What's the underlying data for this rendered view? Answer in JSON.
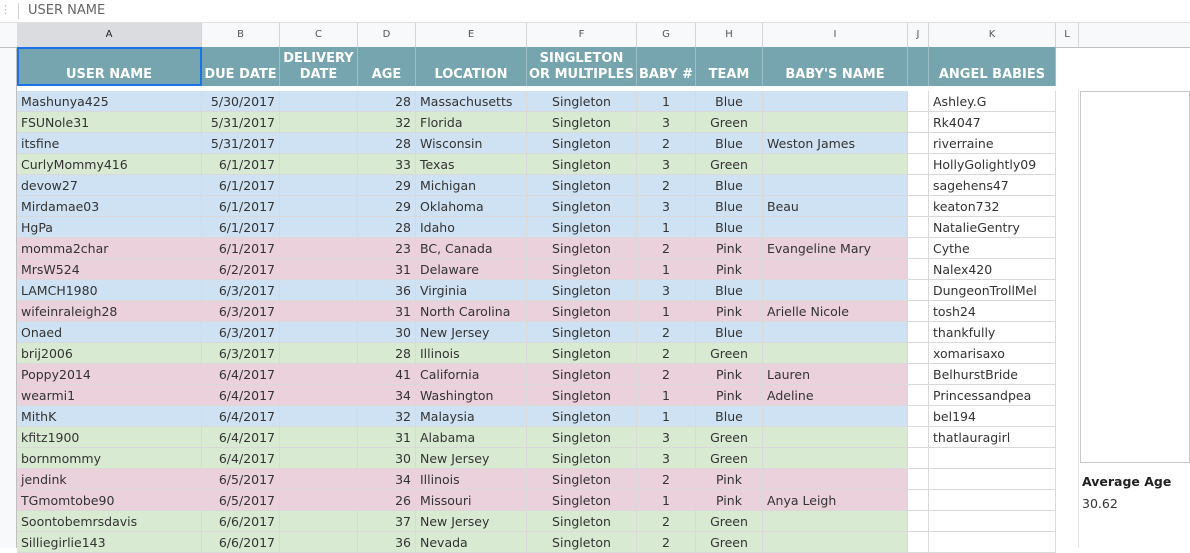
{
  "formula_bar": {
    "value": "USER NAME"
  },
  "columns": [
    "A",
    "B",
    "C",
    "D",
    "E",
    "F",
    "G",
    "H",
    "I",
    "J",
    "K",
    "L"
  ],
  "selected_column": "A",
  "headers": {
    "A": "USER NAME",
    "B": "DUE DATE",
    "C": "DELIVERY DATE",
    "D": "AGE",
    "E": "LOCATION",
    "F": "SINGLETON OR MULTIPLES",
    "G": "BABY #",
    "H": "TEAM",
    "I": "BABY'S NAME",
    "J": "",
    "K": "ANGEL BABIES"
  },
  "colors": {
    "header_bg": "#76a5af",
    "blue": "#cfe2f3",
    "green": "#d9ead3",
    "pink": "#ead1dc"
  },
  "rows": [
    {
      "user": "Mashunya425",
      "due": "5/30/2017",
      "delivery": "",
      "age": "28",
      "location": "Massachusetts",
      "type": "Singleton",
      "baby": "1",
      "team": "Blue",
      "name": "",
      "angel": "Ashley.G"
    },
    {
      "user": "FSUNole31",
      "due": "5/31/2017",
      "delivery": "",
      "age": "32",
      "location": "Florida",
      "type": "Singleton",
      "baby": "3",
      "team": "Green",
      "name": "",
      "angel": "Rk4047"
    },
    {
      "user": "itsfine",
      "due": "5/31/2017",
      "delivery": "",
      "age": "28",
      "location": "Wisconsin",
      "type": "Singleton",
      "baby": "2",
      "team": "Blue",
      "name": "Weston James",
      "angel": "riverraine"
    },
    {
      "user": "CurlyMommy416",
      "due": "6/1/2017",
      "delivery": "",
      "age": "33",
      "location": "Texas",
      "type": "Singleton",
      "baby": "3",
      "team": "Green",
      "name": "",
      "angel": "HollyGolightly09"
    },
    {
      "user": "devow27",
      "due": "6/1/2017",
      "delivery": "",
      "age": "29",
      "location": "Michigan",
      "type": "Singleton",
      "baby": "2",
      "team": "Blue",
      "name": "",
      "angel": "sagehens47"
    },
    {
      "user": "Mirdamae03",
      "due": "6/1/2017",
      "delivery": "",
      "age": "29",
      "location": "Oklahoma",
      "type": "Singleton",
      "baby": "3",
      "team": "Blue",
      "name": "Beau",
      "angel": "keaton732"
    },
    {
      "user": "HgPa",
      "due": "6/1/2017",
      "delivery": "",
      "age": "28",
      "location": "Idaho",
      "type": "Singleton",
      "baby": "1",
      "team": "Blue",
      "name": "",
      "angel": "NatalieGentry"
    },
    {
      "user": "momma2char",
      "due": "6/1/2017",
      "delivery": "",
      "age": "23",
      "location": "BC, Canada",
      "type": "Singleton",
      "baby": "2",
      "team": "Pink",
      "name": "Evangeline Mary",
      "angel": "Cythe"
    },
    {
      "user": "MrsW524",
      "due": "6/2/2017",
      "delivery": "",
      "age": "31",
      "location": "Delaware",
      "type": "Singleton",
      "baby": "1",
      "team": "Pink",
      "name": "",
      "angel": "Nalex420"
    },
    {
      "user": "LAMCH1980",
      "due": "6/3/2017",
      "delivery": "",
      "age": "36",
      "location": "Virginia",
      "type": "Singleton",
      "baby": "3",
      "team": "Blue",
      "name": "",
      "angel": "DungeonTrollMel"
    },
    {
      "user": "wifeinraleigh28",
      "due": "6/3/2017",
      "delivery": "",
      "age": "31",
      "location": "North Carolina",
      "type": "Singleton",
      "baby": "1",
      "team": "Pink",
      "name": "Arielle Nicole",
      "angel": "tosh24"
    },
    {
      "user": "Onaed",
      "due": "6/3/2017",
      "delivery": "",
      "age": "30",
      "location": "New Jersey",
      "type": "Singleton",
      "baby": "2",
      "team": "Blue",
      "name": "",
      "angel": "thankfully"
    },
    {
      "user": "brij2006",
      "due": "6/3/2017",
      "delivery": "",
      "age": "28",
      "location": "Illinois",
      "type": "Singleton",
      "baby": "2",
      "team": "Green",
      "name": "",
      "angel": "xomarisaxo"
    },
    {
      "user": "Poppy2014",
      "due": "6/4/2017",
      "delivery": "",
      "age": "41",
      "location": "California",
      "type": "Singleton",
      "baby": "2",
      "team": "Pink",
      "name": "Lauren",
      "angel": "BelhurstBride"
    },
    {
      "user": "wearmi1",
      "due": "6/4/2017",
      "delivery": "",
      "age": "34",
      "location": "Washington",
      "type": "Singleton",
      "baby": "1",
      "team": "Pink",
      "name": "Adeline",
      "angel": "Princessandpea"
    },
    {
      "user": "MithK",
      "due": "6/4/2017",
      "delivery": "",
      "age": "32",
      "location": "Malaysia",
      "type": "Singleton",
      "baby": "1",
      "team": "Blue",
      "name": "",
      "angel": "bel194"
    },
    {
      "user": "kfitz1900",
      "due": "6/4/2017",
      "delivery": "",
      "age": "31",
      "location": "Alabama",
      "type": "Singleton",
      "baby": "3",
      "team": "Green",
      "name": "",
      "angel": "thatlauragirl"
    },
    {
      "user": "bornmommy",
      "due": "6/4/2017",
      "delivery": "",
      "age": "30",
      "location": "New Jersey",
      "type": "Singleton",
      "baby": "3",
      "team": "Green",
      "name": "",
      "angel": ""
    },
    {
      "user": "jendink",
      "due": "6/5/2017",
      "delivery": "",
      "age": "34",
      "location": "Illinois",
      "type": "Singleton",
      "baby": "2",
      "team": "Pink",
      "name": "",
      "angel": ""
    },
    {
      "user": "TGmomtobe90",
      "due": "6/5/2017",
      "delivery": "",
      "age": "26",
      "location": "Missouri",
      "type": "Singleton",
      "baby": "1",
      "team": "Pink",
      "name": "Anya Leigh",
      "angel": ""
    },
    {
      "user": "Soontobemrsdavis",
      "due": "6/6/2017",
      "delivery": "",
      "age": "37",
      "location": "New Jersey",
      "type": "Singleton",
      "baby": "2",
      "team": "Green",
      "name": "",
      "angel": ""
    },
    {
      "user": "Silliegirlie143",
      "due": "6/6/2017",
      "delivery": "",
      "age": "36",
      "location": "Nevada",
      "type": "Singleton",
      "baby": "2",
      "team": "Green",
      "name": "",
      "angel": ""
    }
  ],
  "summary": {
    "label": "Average Age",
    "value": "30.62"
  }
}
